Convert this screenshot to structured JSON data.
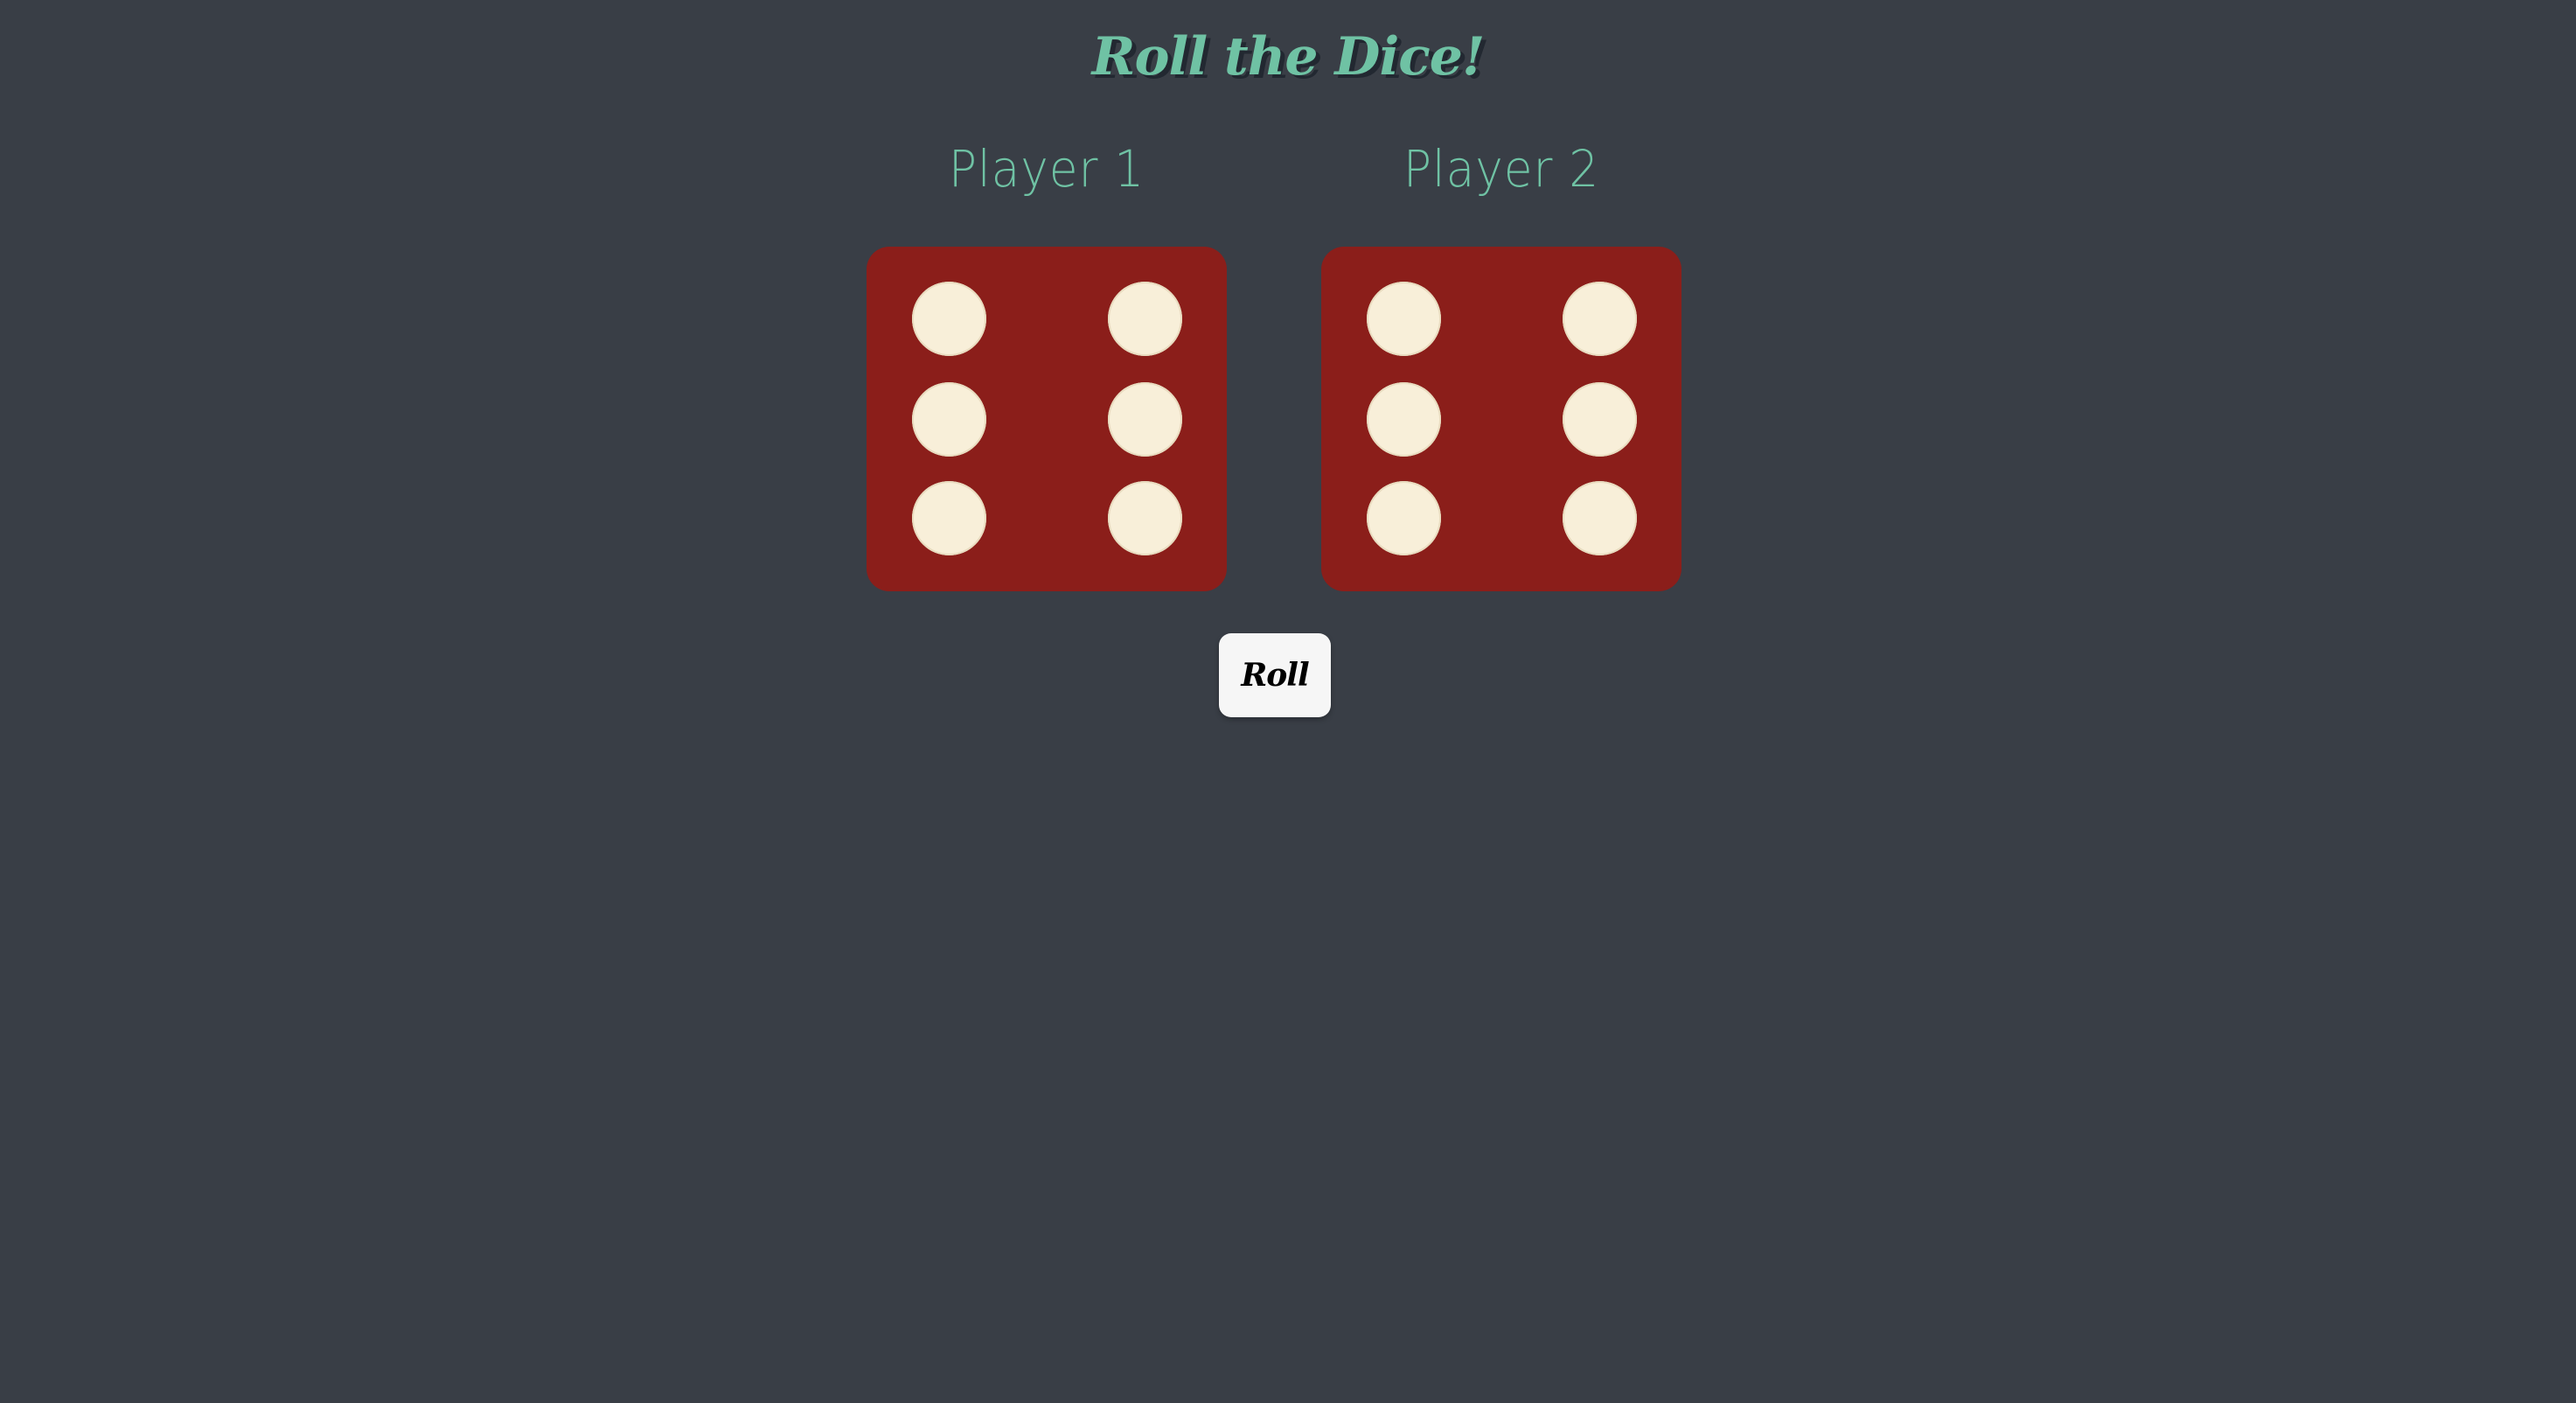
{
  "page": {
    "title": "Roll the Dice!"
  },
  "players": [
    {
      "name": "Player 1",
      "die_value": 6
    },
    {
      "name": "Player 2",
      "die_value": 6
    }
  ],
  "controls": {
    "roll_label": "Roll"
  },
  "colors": {
    "background": "#393e46",
    "accent": "#6fc2a4",
    "die_face": "#8b1e1a",
    "pip": "#f8efd9",
    "button": "#f6f6f6"
  }
}
